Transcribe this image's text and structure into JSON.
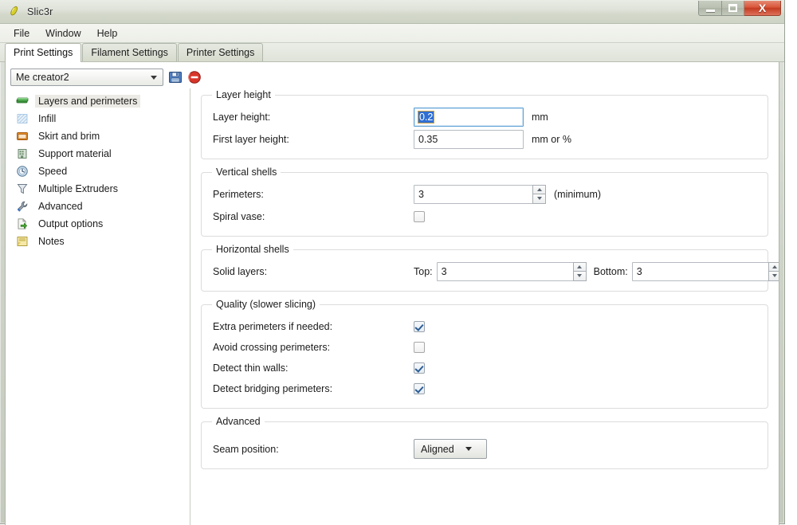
{
  "window": {
    "title": "Slic3r",
    "app_icon": "slic3r-icon",
    "controls": {
      "minimize": "minimize-icon",
      "maximize": "maximize-icon",
      "close": "X"
    }
  },
  "menubar": {
    "items": [
      {
        "label": "File"
      },
      {
        "label": "Window"
      },
      {
        "label": "Help"
      }
    ]
  },
  "tabs": [
    {
      "label": "Print Settings",
      "active": true
    },
    {
      "label": "Filament Settings",
      "active": false
    },
    {
      "label": "Printer Settings",
      "active": false
    }
  ],
  "preset": {
    "value": "Me creator2",
    "save_icon": "floppy-save-icon",
    "delete_icon": "delete-circle-icon"
  },
  "sidebar": {
    "items": [
      {
        "label": "Layers and perimeters",
        "icon": "layers-icon",
        "selected": true
      },
      {
        "label": "Infill",
        "icon": "infill-icon",
        "selected": false
      },
      {
        "label": "Skirt and brim",
        "icon": "skirt-icon",
        "selected": false
      },
      {
        "label": "Support material",
        "icon": "support-icon",
        "selected": false
      },
      {
        "label": "Speed",
        "icon": "speed-icon",
        "selected": false
      },
      {
        "label": "Multiple Extruders",
        "icon": "extruder-icon",
        "selected": false
      },
      {
        "label": "Advanced",
        "icon": "wrench-icon",
        "selected": false
      },
      {
        "label": "Output options",
        "icon": "output-icon",
        "selected": false
      },
      {
        "label": "Notes",
        "icon": "notes-icon",
        "selected": false
      }
    ]
  },
  "groups": {
    "layer_height": {
      "legend": "Layer height",
      "layer_height_label": "Layer height:",
      "layer_height_value": "0.2",
      "layer_height_unit": "mm",
      "first_layer_label": "First layer height:",
      "first_layer_value": "0.35",
      "first_layer_unit": "mm or %"
    },
    "vertical_shells": {
      "legend": "Vertical shells",
      "perimeters_label": "Perimeters:",
      "perimeters_value": "3",
      "perimeters_unit": "(minimum)",
      "spiral_vase_label": "Spiral vase:",
      "spiral_vase_checked": false
    },
    "horizontal_shells": {
      "legend": "Horizontal shells",
      "solid_layers_label": "Solid layers:",
      "top_label": "Top:",
      "top_value": "3",
      "bottom_label": "Bottom:",
      "bottom_value": "3"
    },
    "quality": {
      "legend": "Quality (slower slicing)",
      "rows": [
        {
          "label": "Extra perimeters if needed:",
          "checked": true
        },
        {
          "label": "Avoid crossing perimeters:",
          "checked": false
        },
        {
          "label": "Detect thin walls:",
          "checked": true
        },
        {
          "label": "Detect bridging perimeters:",
          "checked": true
        }
      ]
    },
    "advanced": {
      "legend": "Advanced",
      "seam_label": "Seam position:",
      "seam_value": "Aligned"
    }
  },
  "colors": {
    "accent_selection": "#2f6fd4",
    "focus_border": "#5a9fd4",
    "close_button": "#c33c21",
    "checkbox_check": "#2b5d96"
  }
}
